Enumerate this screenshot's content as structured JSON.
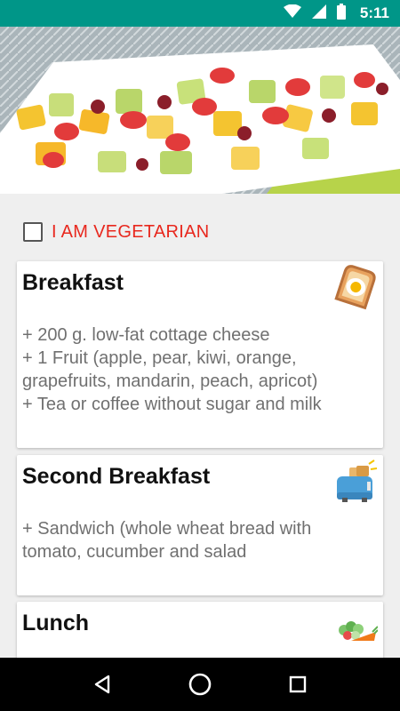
{
  "status_bar": {
    "time": "5:11",
    "icons": [
      "wifi-icon",
      "signal-icon",
      "battery-icon"
    ]
  },
  "hero": {
    "image": "fruit salad on a white plate",
    "accent_colors": [
      "#e23b3b",
      "#f6c12e",
      "#b9d66a",
      "#8b1e2a"
    ]
  },
  "vegetarian_option": {
    "label": "I AM VEGETARIAN",
    "checked": false,
    "color": "#e8281e"
  },
  "meals": [
    {
      "title": "Breakfast",
      "icon": "toast-egg-icon",
      "items": [
        "+ 200 g. low-fat cottage cheese",
        "+ 1 Fruit (apple, pear, kiwi, orange,",
        "grapefruits, mandarin, peach, apricot)",
        "+ Tea or coffee without sugar and milk"
      ]
    },
    {
      "title": "Second Breakfast",
      "icon": "toaster-icon",
      "items": [
        "+ Sandwich (whole wheat bread with",
        "tomato, cucumber and salad"
      ]
    },
    {
      "title": "Lunch",
      "icon": "salad-carrot-icon",
      "items": []
    }
  ],
  "nav_bar": {
    "buttons": [
      "back-icon",
      "home-icon",
      "recents-icon"
    ]
  }
}
